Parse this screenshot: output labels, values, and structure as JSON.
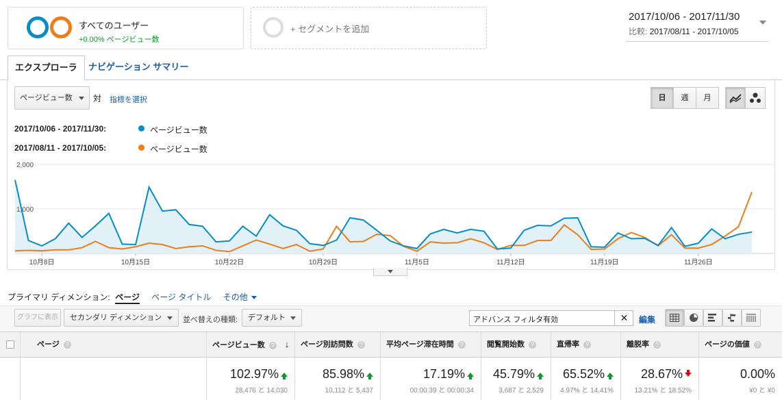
{
  "segments": {
    "all_users": {
      "title": "すべてのユーザー",
      "subtitle": "+0.00% ページビュー数"
    },
    "add_segment": "+ セグメントを追加"
  },
  "date_range": {
    "main": "2017/10/06 - 2017/11/30",
    "compare_label": "比較:",
    "compare": "2017/08/11 - 2017/10/05"
  },
  "tabs": [
    {
      "label": "エクスプローラ",
      "active": true
    },
    {
      "label": "ナビゲーション サマリー",
      "active": false
    }
  ],
  "controls": {
    "metric_select": "ページビュー数",
    "vs": "対",
    "select_metric_link": "指標を選択",
    "period_buttons": [
      "日",
      "週",
      "月"
    ],
    "active_period": "日"
  },
  "legend": [
    {
      "range": "2017/10/06 - 2017/11/30:",
      "metric": "ページビュー数",
      "color": "#058dc7"
    },
    {
      "range": "2017/08/11 - 2017/10/05:",
      "metric": "ページビュー数",
      "color": "#ed7e17"
    }
  ],
  "chart_data": {
    "type": "line",
    "y_ticks": [
      "2,000",
      "1,000"
    ],
    "ylim": [
      0,
      2000
    ],
    "x_labels": [
      "10月8日",
      "10月15日",
      "10月22日",
      "10月29日",
      "11月5日",
      "11月12日",
      "11月19日",
      "11月26日"
    ],
    "x": [
      "10/06",
      "10/07",
      "10/08",
      "10/09",
      "10/10",
      "10/11",
      "10/12",
      "10/13",
      "10/14",
      "10/15",
      "10/16",
      "10/17",
      "10/18",
      "10/19",
      "10/20",
      "10/21",
      "10/22",
      "10/23",
      "10/24",
      "10/25",
      "10/26",
      "10/27",
      "10/28",
      "10/29",
      "10/30",
      "10/31",
      "11/01",
      "11/02",
      "11/03",
      "11/04",
      "11/05",
      "11/06",
      "11/07",
      "11/08",
      "11/09",
      "11/10",
      "11/11",
      "11/12",
      "11/13",
      "11/14",
      "11/15",
      "11/16",
      "11/17",
      "11/18",
      "11/19",
      "11/20",
      "11/21",
      "11/22",
      "11/23",
      "11/24",
      "11/25",
      "11/26",
      "11/27",
      "11/28",
      "11/29",
      "11/30"
    ],
    "series": [
      {
        "name": "2017/10/06 - 2017/11/30",
        "color": "#058dc7",
        "values": [
          1650,
          290,
          170,
          330,
          680,
          360,
          620,
          900,
          210,
          200,
          1490,
          950,
          980,
          650,
          610,
          260,
          280,
          610,
          390,
          870,
          620,
          520,
          220,
          180,
          300,
          800,
          750,
          520,
          280,
          170,
          110,
          440,
          540,
          460,
          540,
          500,
          100,
          120,
          520,
          630,
          620,
          790,
          800,
          150,
          140,
          460,
          330,
          340,
          180,
          580,
          160,
          230,
          550,
          330,
          430,
          480
        ]
      },
      {
        "name": "2017/08/11 - 2017/10/05",
        "color": "#ed7e17",
        "values": [
          60,
          70,
          60,
          80,
          80,
          130,
          270,
          130,
          100,
          150,
          230,
          200,
          110,
          150,
          170,
          70,
          40,
          170,
          300,
          210,
          110,
          200,
          50,
          100,
          610,
          260,
          270,
          430,
          400,
          160,
          50,
          260,
          230,
          240,
          330,
          240,
          90,
          180,
          180,
          290,
          290,
          640,
          420,
          90,
          100,
          330,
          470,
          360,
          170,
          420,
          120,
          120,
          200,
          390,
          600,
          1380
        ]
      }
    ]
  },
  "dimension": {
    "label": "プライマリ ディメンション:",
    "active": "ページ",
    "options": [
      "ページ タイトル",
      "その他"
    ]
  },
  "toolbar": {
    "graph_button": "グラフに表示",
    "secondary_dimension": "セカンダリ ディメンション",
    "sort_label": "並べ替えの種類:",
    "sort_value": "デフォルト",
    "filter_value": "アドバンス フィルタ有効",
    "edit_link": "編集"
  },
  "table": {
    "columns": [
      {
        "label": "ページ",
        "help": "?"
      },
      {
        "label": "ページビュー数",
        "help": "?"
      },
      {
        "label": "ページ別訪問数",
        "help": "?"
      },
      {
        "label": "平均ページ滞在時間",
        "help": "?"
      },
      {
        "label": "閲覧開始数",
        "help": "?"
      },
      {
        "label": "直帰率",
        "help": "?"
      },
      {
        "label": "離脱率",
        "help": "?"
      },
      {
        "label": "ページの価値",
        "help": "?"
      }
    ],
    "totals": [
      {
        "value": "102.97%",
        "trend": "up",
        "detail": "28,476 と 14,030"
      },
      {
        "value": "85.98%",
        "trend": "up",
        "detail": "10,112 と 5,437"
      },
      {
        "value": "17.19%",
        "trend": "up",
        "detail": "00:00:39 と 00:00:34"
      },
      {
        "value": "45.79%",
        "trend": "up",
        "detail": "3,687 と 2,529"
      },
      {
        "value": "65.52%",
        "trend": "up",
        "detail": "4.97% と 14.41%"
      },
      {
        "value": "28.67%",
        "trend": "down",
        "detail": "13.21% と 18.52%"
      },
      {
        "value": "0.00%",
        "trend": "",
        "detail": "¥0 と ¥0"
      }
    ]
  }
}
